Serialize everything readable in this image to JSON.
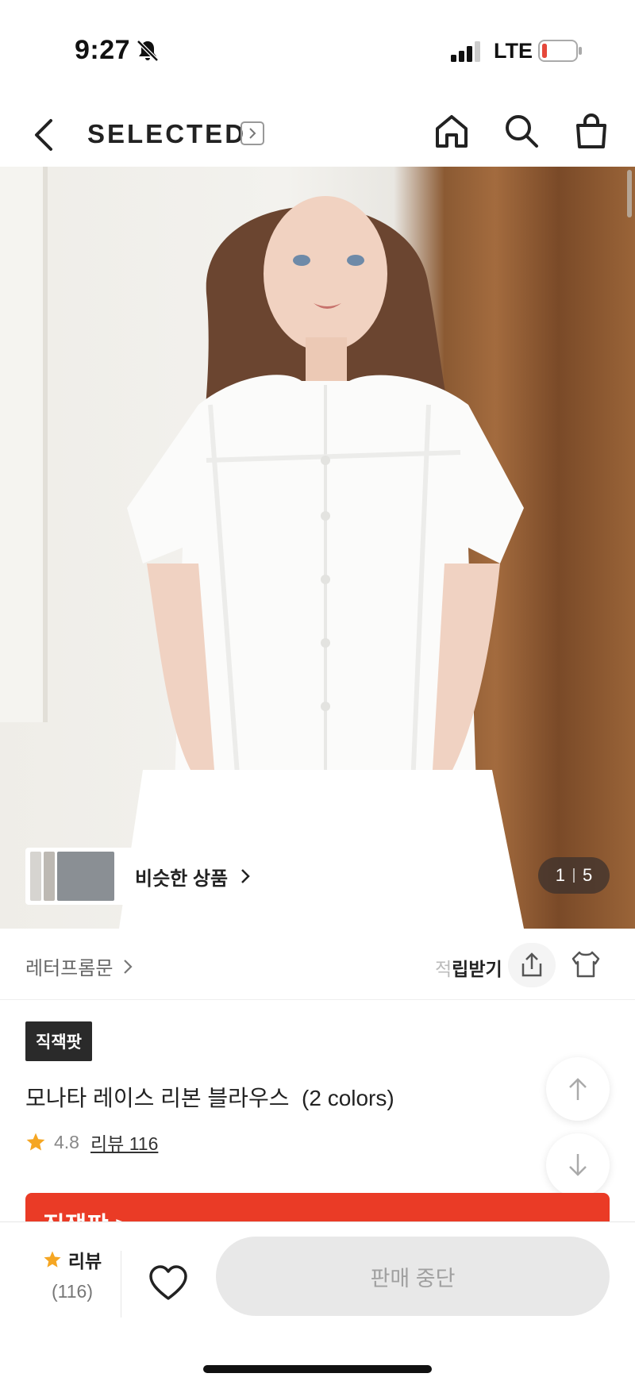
{
  "status_bar": {
    "time": "9:27",
    "network": "LTE",
    "icons": [
      "bell-slash-icon",
      "signal-icon",
      "battery-low-icon"
    ],
    "battery_color": "#e5483b"
  },
  "header": {
    "brand": "SELECTED",
    "icons": [
      "back-icon",
      "chevron-right-icon",
      "home-icon",
      "search-icon",
      "shopping-bag-icon"
    ]
  },
  "hero": {
    "similar_label": "비슷한 상품",
    "page_current": "1",
    "page_total": "5"
  },
  "brand_row": {
    "store_name": "레터프롬문",
    "points_prefix": "적",
    "points_label": "립받기",
    "icons": [
      "share-icon",
      "hanger-icon"
    ]
  },
  "product": {
    "badge": "직잭팟",
    "title": "모나타 레이스 리본 블라우스  (2 colors)",
    "rating": "4.8",
    "review_link": "리뷰 116",
    "promo_text": "직잭팟 >",
    "accent_color": "#ea3b26"
  },
  "bottom_bar": {
    "review_label": "리뷰",
    "review_count": "(116)",
    "buy_button": "판매 중단",
    "star_color": "#f5a623"
  }
}
